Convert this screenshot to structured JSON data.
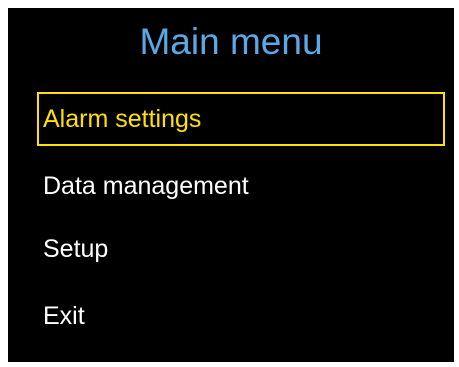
{
  "menu": {
    "title": "Main menu",
    "items": [
      {
        "label": "Alarm settings",
        "selected": true
      },
      {
        "label": "Data management",
        "selected": false
      },
      {
        "label": "Setup",
        "selected": false
      },
      {
        "label": "Exit",
        "selected": false
      }
    ]
  },
  "colors": {
    "background": "#000000",
    "title": "#5aa9e6",
    "item_text": "#ffffff",
    "selection": "#ffe100"
  }
}
